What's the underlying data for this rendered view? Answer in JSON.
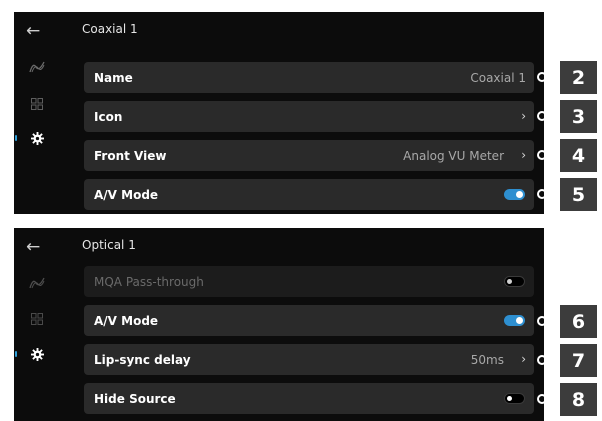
{
  "colors": {
    "accent": "#2e8fd0",
    "panel_bg": "#0c0c0c",
    "row_bg": "#2a2a2a",
    "badge_bg": "#3c3c3c"
  },
  "screens": [
    {
      "back_icon": "arrow-left-icon",
      "title": "Coaxial 1",
      "sidebar": [
        "waveform-icon",
        "grid-icon",
        "gear-icon"
      ],
      "rows": [
        {
          "label": "Name",
          "value": "Coaxial 1",
          "control": "none",
          "callout": "2"
        },
        {
          "label": "Icon",
          "value": "",
          "control": "chevron",
          "callout": "3"
        },
        {
          "label": "Front View",
          "value": "Analog VU Meter",
          "control": "chevron",
          "callout": "4"
        },
        {
          "label": "A/V Mode",
          "value": "",
          "control": "toggle-on",
          "callout": "5"
        }
      ]
    },
    {
      "back_icon": "arrow-left-icon",
      "title": "Optical 1",
      "sidebar": [
        "waveform-icon",
        "grid-icon",
        "gear-icon"
      ],
      "rows": [
        {
          "label": "MQA Pass-through",
          "value": "",
          "control": "toggle-off-disabled",
          "callout": ""
        },
        {
          "label": "A/V Mode",
          "value": "",
          "control": "toggle-on",
          "callout": "6"
        },
        {
          "label": "Lip-sync delay",
          "value": "50ms",
          "control": "chevron",
          "callout": "7"
        },
        {
          "label": "Hide Source",
          "value": "",
          "control": "toggle-off",
          "callout": "8"
        }
      ]
    }
  ]
}
